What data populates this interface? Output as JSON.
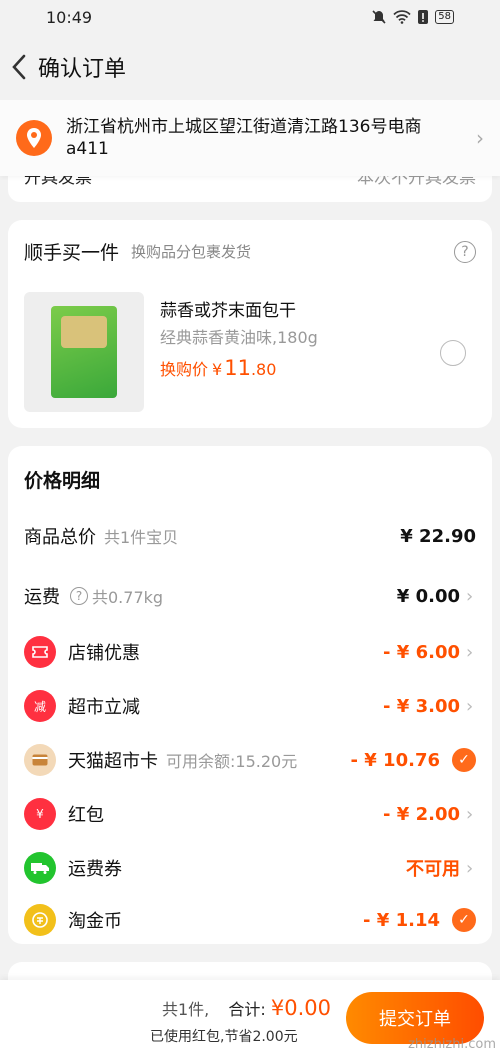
{
  "status": {
    "time": "10:49",
    "battery": "58"
  },
  "nav": {
    "title": "确认订单"
  },
  "address": {
    "text": "浙江省杭州市上城区望江街道清江路136号电商a411"
  },
  "invoice": {
    "label": "开具发票",
    "value": "本次不开具发票"
  },
  "addon": {
    "title": "顺手买一件",
    "subtitle": "换购品分包裹发货",
    "product": {
      "name": "蒜香或芥末面包干",
      "spec": "经典蒜香黄油味,180g",
      "price_label": "换购价",
      "currency": "¥",
      "price_int": "11",
      "price_dec": ".80"
    }
  },
  "price_detail": {
    "title": "价格明细",
    "rows": [
      {
        "label": "商品总价",
        "sub": "共1件宝贝",
        "value": "¥ 22.90"
      },
      {
        "label": "运费",
        "sub": "共0.77kg",
        "value": "¥ 0.00"
      },
      {
        "label": "店铺优惠",
        "value": "- ¥ 6.00"
      },
      {
        "label": "超市立减",
        "value": "- ¥ 3.00"
      },
      {
        "label": "天猫超市卡",
        "sub": "可用余额:15.20元",
        "value": "- ¥ 10.76"
      },
      {
        "label": "红包",
        "value": "- ¥ 2.00"
      },
      {
        "label": "运费券",
        "value": "不可用"
      },
      {
        "label": "淘金币",
        "value": "- ¥ 1.14"
      }
    ],
    "icons": {
      "coupon_text": "减",
      "red_packet_text": "¥"
    }
  },
  "footer": {
    "count": "共1件,",
    "total_label": "合计:",
    "amount": "¥0.00",
    "savings": "已使用红包,节省2.00元",
    "submit": "提交订单"
  },
  "watermark": "zhizhizhi.com",
  "colors": {
    "accent": "#ff5000",
    "orange": "#ff6a1a"
  }
}
